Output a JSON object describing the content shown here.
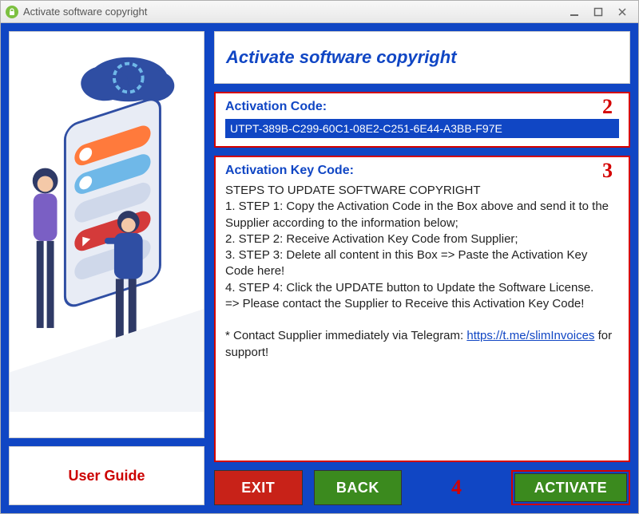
{
  "window": {
    "title": "Activate software copyright"
  },
  "header": {
    "title": "Activate software copyright"
  },
  "guide": {
    "label": "User Guide"
  },
  "activation_code": {
    "label": "Activation Code:",
    "value": "UTPT-389B-C299-60C1-08E2-C251-6E44-A3BB-F97E",
    "marker": "2"
  },
  "key_code": {
    "label": "Activation Key Code:",
    "marker": "3",
    "heading": "STEPS TO UPDATE SOFTWARE COPYRIGHT",
    "step1": "1. STEP 1: Copy the Activation Code in the Box above and send it to the Supplier according to the information below;",
    "step2": "2. STEP 2: Receive Activation Key Code from Supplier;",
    "step3": "3. STEP 3: Delete all content in this Box => Paste the Activation Key Code here!",
    "step4": "4. STEP 4: Click the UPDATE button to Update the Software License.",
    "note": "=> Please contact the Supplier to Receive this Activation Key Code!",
    "contact_prefix": "* Contact Supplier immediately via Telegram: ",
    "contact_link": "https://t.me/slimInvoices",
    "contact_suffix": " for support!"
  },
  "buttons": {
    "exit": "EXIT",
    "back": "BACK",
    "activate": "ACTIVATE",
    "activate_marker": "4"
  }
}
